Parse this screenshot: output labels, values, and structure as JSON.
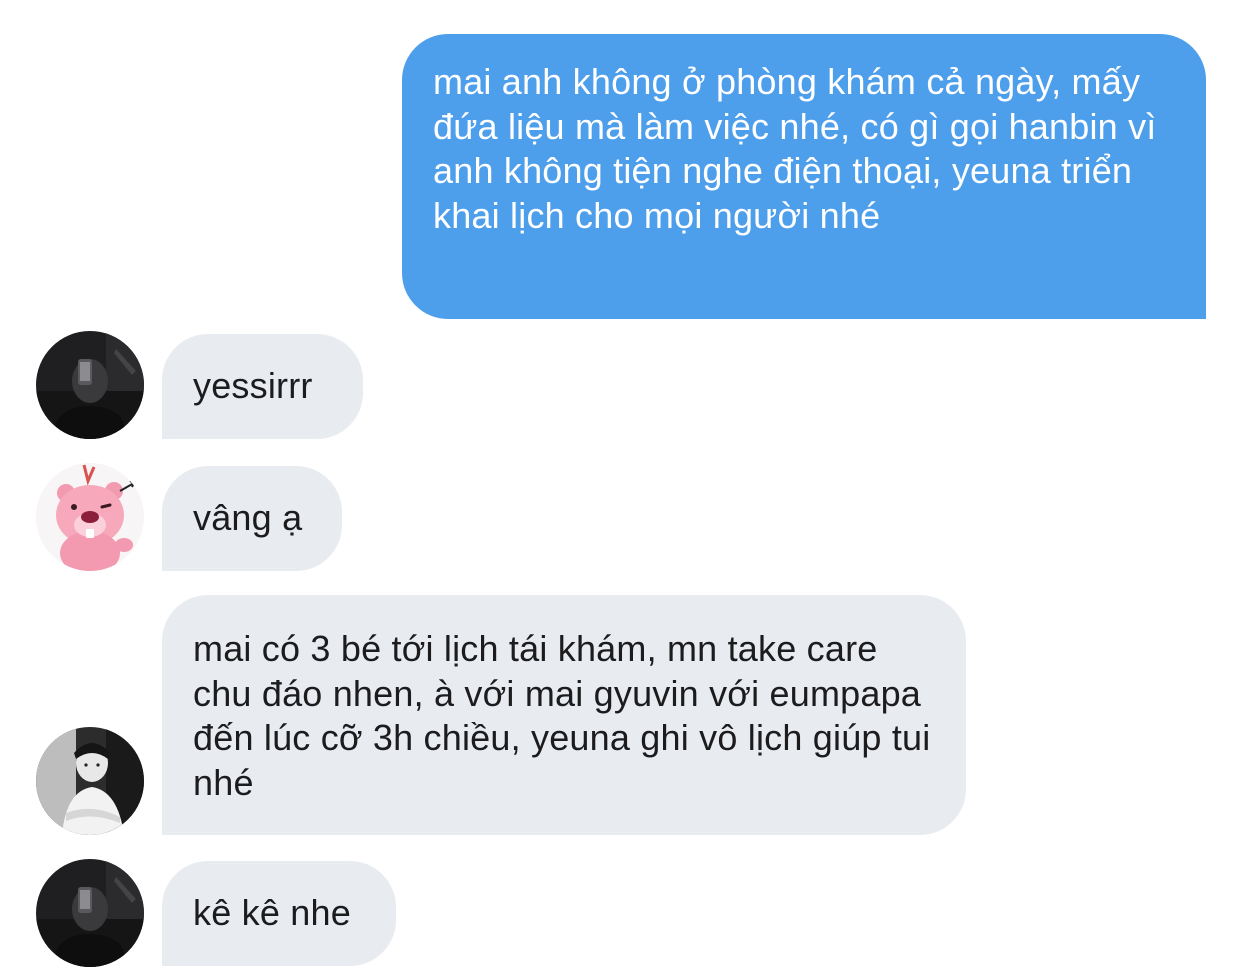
{
  "messages": [
    {
      "direction": "outgoing",
      "text": "mai anh không ở phòng khám cả ngày, mấy đứa liệu mà làm việc nhé, có gì gọi hanbin vì anh không tiện nghe điện thoại, yeuna triển khai lịch cho mọi người nhé"
    },
    {
      "direction": "incoming",
      "avatar": "dark-mirror-selfie-avatar",
      "text": "yessirrr"
    },
    {
      "direction": "incoming",
      "avatar": "pink-beaver-avatar",
      "text": "vâng ạ"
    },
    {
      "direction": "incoming",
      "avatar": "bw-portrait-avatar",
      "text": "mai có 3 bé tới lịch tái khám, mn take care chu đáo nhen, à với mai gyuvin với eumpapa đến lúc cỡ 3h chiều, yeuna ghi vô lịch giúp tui nhé"
    },
    {
      "direction": "incoming",
      "avatar": "dark-mirror-selfie-avatar",
      "text": "kê kê nhe"
    }
  ],
  "colors": {
    "outgoing_bubble": "#4d9eeb",
    "incoming_bubble": "#e8ebef",
    "incoming_text": "#1c1c1e",
    "outgoing_text": "#ffffff"
  }
}
